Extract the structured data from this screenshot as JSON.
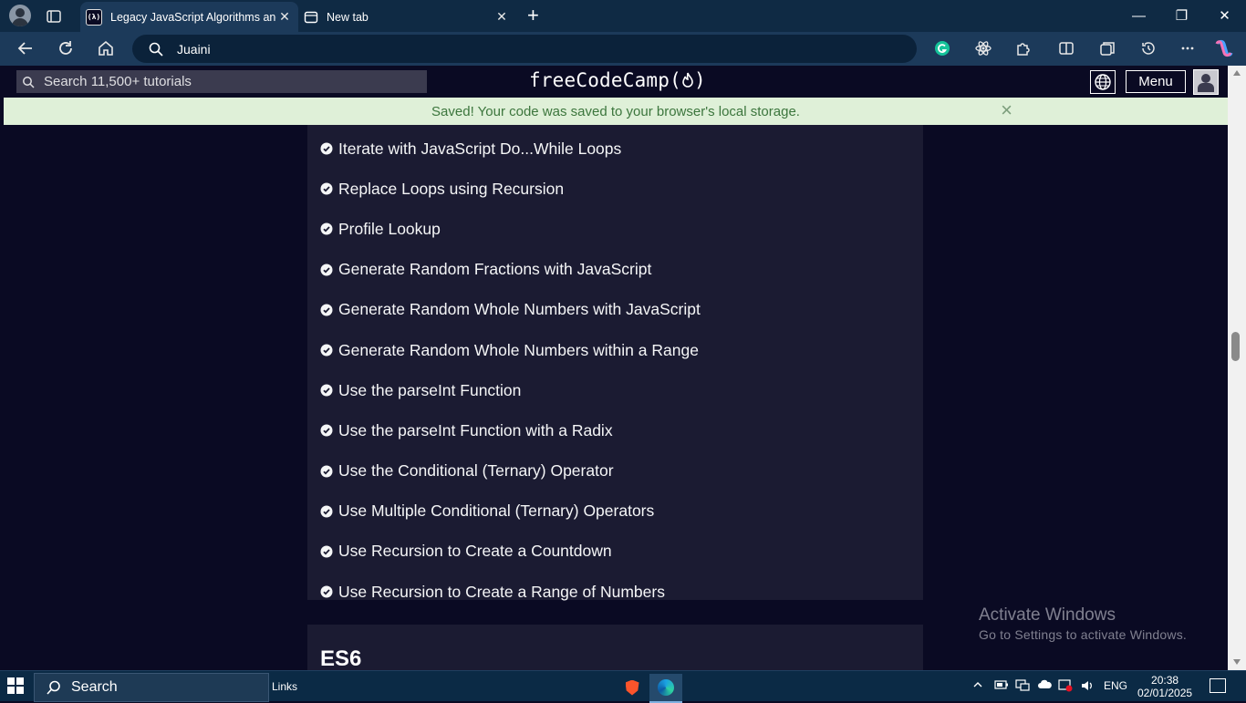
{
  "browser": {
    "tabs": [
      {
        "title": "Legacy JavaScript Algorithms and",
        "favicon": "(λ)",
        "active": true
      },
      {
        "title": "New tab",
        "favicon": "",
        "active": false
      }
    ],
    "address": "Juaini"
  },
  "fcc": {
    "search_placeholder": "Search 11,500+ tutorials",
    "logo": "freeCodeCamp(🔥)",
    "logo_text": "freeCodeCamp",
    "menu_label": "Menu"
  },
  "flash": {
    "message": "Saved! Your code was saved to your browser's local storage.",
    "close": "×"
  },
  "challenges": [
    "Iterate with JavaScript Do...While Loops",
    "Replace Loops using Recursion",
    "Profile Lookup",
    "Generate Random Fractions with JavaScript",
    "Generate Random Whole Numbers with JavaScript",
    "Generate Random Whole Numbers within a Range",
    "Use the parseInt Function",
    "Use the parseInt Function with a Radix",
    "Use the Conditional (Ternary) Operator",
    "Use Multiple Conditional (Ternary) Operators",
    "Use Recursion to Create a Countdown",
    "Use Recursion to Create a Range of Numbers"
  ],
  "next_section": "ES6",
  "watermark": {
    "line1": "Activate Windows",
    "line2": "Go to Settings to activate Windows."
  },
  "taskbar": {
    "search": "Search",
    "links": "Links",
    "lang": "ENG",
    "time": "20:38",
    "date": "02/01/2025"
  },
  "colors": {
    "fcc_bg": "#0a0a23",
    "fcc_block": "#1b1b32",
    "flash_bg": "#dff0d8",
    "flash_text": "#3c763d",
    "browser_frame": "#0f2a44"
  }
}
